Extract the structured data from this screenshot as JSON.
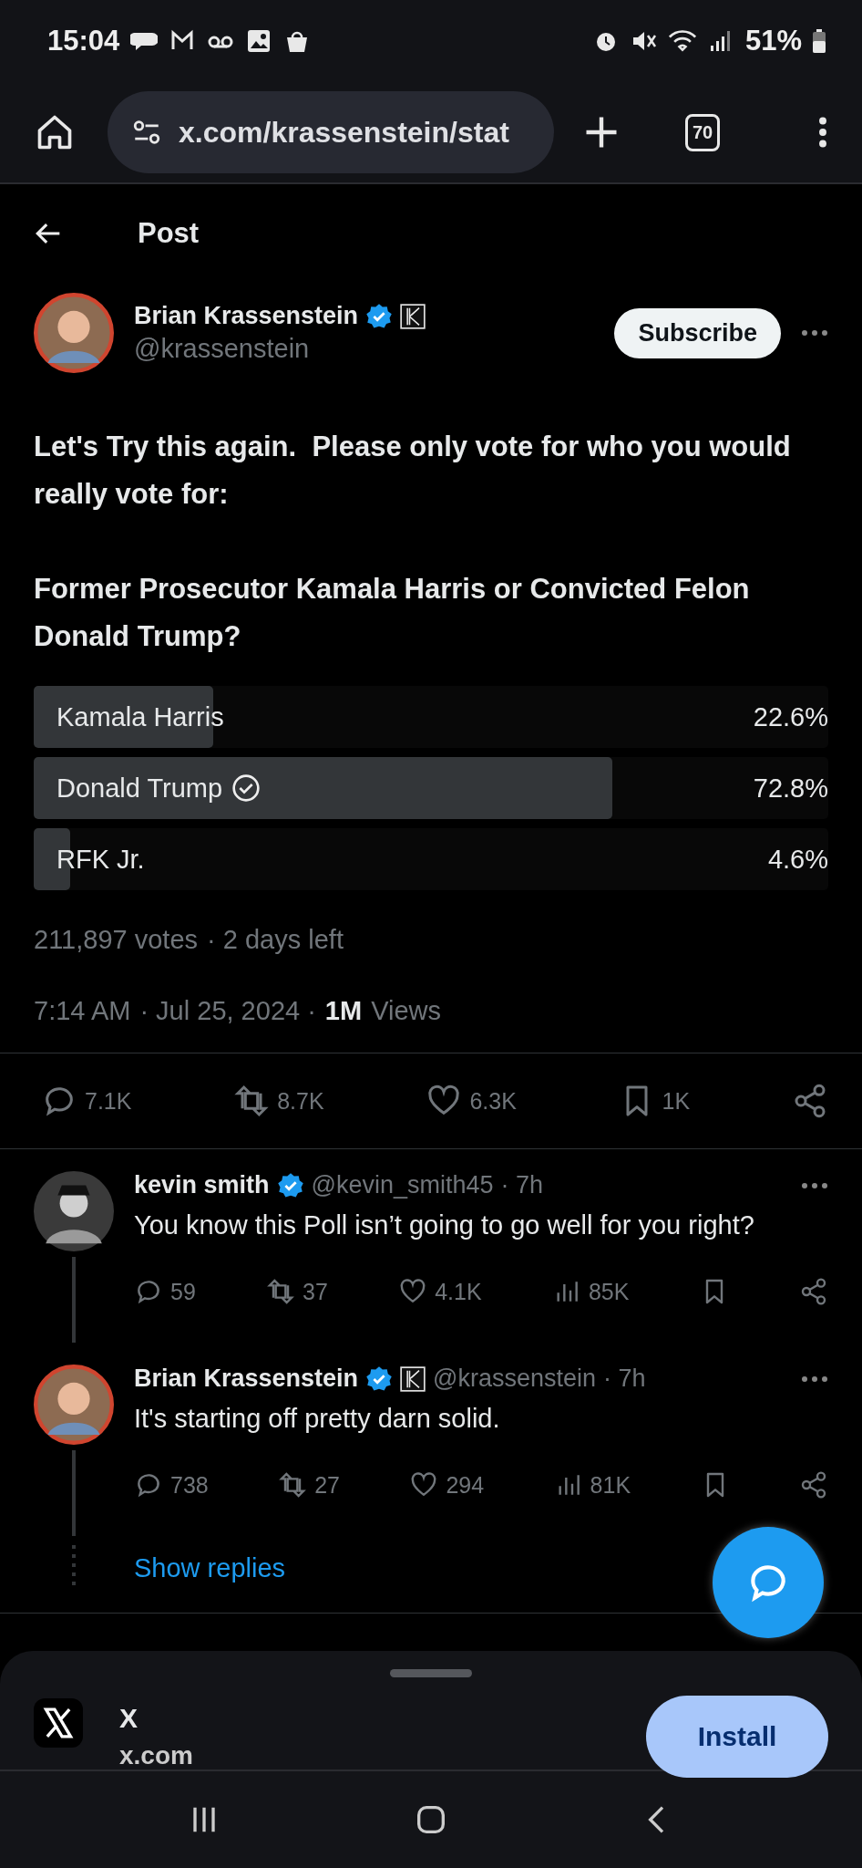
{
  "status_bar": {
    "time": "15:04",
    "battery": "51%"
  },
  "browser": {
    "url": "x.com/krassenstein/stat",
    "tab_count": "70"
  },
  "header": {
    "title": "Post"
  },
  "post": {
    "author": {
      "name": "Brian Krassenstein",
      "handle": "@krassenstein",
      "verified": true,
      "badge": true
    },
    "subscribe_label": "Subscribe",
    "text_lines": [
      "Let's Try this again.  Please only vote for who you would really vote for:",
      "Former Prosecutor Kamala Harris or Convicted Felon Donald Trump?"
    ],
    "poll": {
      "options": [
        {
          "label": "Kamala Harris",
          "percent": "22.6%",
          "level": 0.226,
          "voted": false
        },
        {
          "label": "Donald Trump",
          "percent": "72.8%",
          "level": 0.728,
          "voted": true
        },
        {
          "label": "RFK Jr.",
          "percent": "4.6%",
          "level": 0.046,
          "voted": false
        }
      ],
      "votes": "211,897 votes",
      "time_left": "· 2 days left"
    },
    "time": "7:14 AM",
    "date": "· Jul 25, 2024 ·",
    "views_count": "1M",
    "views_label": "Views",
    "actions": [
      {
        "kind": "reply",
        "count": "7.1K"
      },
      {
        "kind": "repost",
        "count": "8.7K"
      },
      {
        "kind": "like",
        "count": "6.3K"
      },
      {
        "kind": "bookmark",
        "count": "1K"
      },
      {
        "kind": "share"
      }
    ]
  },
  "replies": [
    {
      "name": "kevin smith",
      "verified": true,
      "badge": false,
      "handle": "@kevin_smith45",
      "age": "· 7h",
      "avatar": {
        "kind": "dark"
      },
      "text": "You know this Poll isn’t going to go well for you right?",
      "actions": [
        {
          "kind": "reply",
          "count": "59"
        },
        {
          "kind": "repost",
          "count": "37"
        },
        {
          "kind": "like",
          "count": "4.1K"
        },
        {
          "kind": "views",
          "count": "85K"
        },
        {
          "kind": "bookmark"
        },
        {
          "kind": "share"
        }
      ]
    },
    {
      "name": "Brian Krassenstein",
      "verified": true,
      "badge": true,
      "handle": "@krassenstein",
      "age": "· 7h",
      "avatar": {
        "kind": "ringed"
      },
      "text": "It's starting off pretty darn solid.",
      "actions": [
        {
          "kind": "reply",
          "count": "738"
        },
        {
          "kind": "repost",
          "count": "27"
        },
        {
          "kind": "like",
          "count": "294"
        },
        {
          "kind": "views",
          "count": "81K"
        },
        {
          "kind": "bookmark"
        },
        {
          "kind": "share"
        }
      ]
    }
  ],
  "show_replies": "Show replies",
  "install_sheet": {
    "app_name": "X",
    "domain": "x.com",
    "button": "Install"
  }
}
